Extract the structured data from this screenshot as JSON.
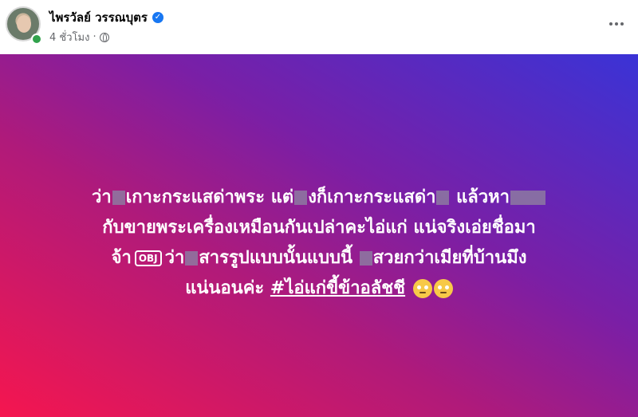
{
  "header": {
    "author_name": "ไพรวัลย์ วรรณบุตร",
    "time": "4 ชั่วโมง",
    "separator": "·",
    "verified_glyph": "✓"
  },
  "post": {
    "line1_a": "ว่า",
    "line1_b": "เกาะกระแสด่าพระ แต่",
    "line1_c": "งก็เกาะกระแสด่า",
    "line1_d": " แล้วหา",
    "line2": "กับขายพระเครื่องเหมือนกันเปล่าคะไอ่แก่ แน่จริงเอ่ยชื่อมา",
    "line3_a": "จ้า",
    "obj_label": "OBJ",
    "line3_b": "ว่า",
    "line3_c": "สารรูปแบบนั้นแบบนี้ ",
    "line3_d": "สวยกว่าเมียที่บ้านมึง",
    "line4": "แน่นอนค่ะ ",
    "hashtag": "#ไอ่แก่ขี้ข้าอลัชชี",
    "gradient_colors": [
      "#f5164f",
      "#b01a7a",
      "#7a1fa6",
      "#3a33d6"
    ]
  },
  "icons": {
    "verified": "verified-badge-icon",
    "globe": "globe-icon",
    "more": "more-options-icon",
    "emoji": "rolling-eyes-emoji"
  }
}
